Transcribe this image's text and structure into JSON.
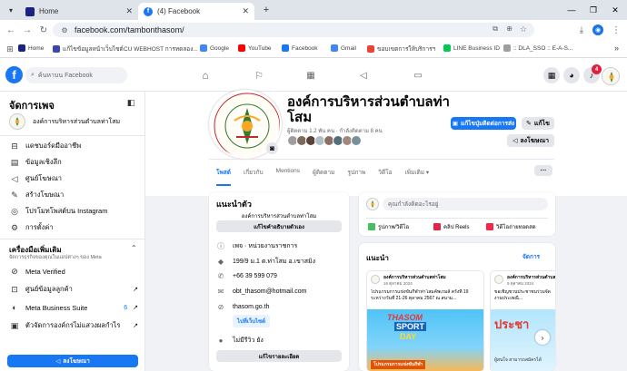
{
  "browser": {
    "tabs": [
      {
        "title": "Home",
        "active": false
      },
      {
        "title": "(4) Facebook",
        "active": true
      }
    ],
    "new_tab_label": "+",
    "url": "facebook.com/tambonthasom/",
    "bookmarks": [
      {
        "label": "Home",
        "color": "#1a237e"
      },
      {
        "label": "แก้ไขข้อมูลหน้าเว็บไซต์",
        "color": "#3949ab"
      },
      {
        "label": "CU WEBHOST การทดลอง...",
        "color": "#9e9e9e"
      },
      {
        "label": "Google",
        "color": "#4285f4"
      },
      {
        "label": "YouTube",
        "color": "#ff0000"
      },
      {
        "label": "Facebook",
        "color": "#1877f2"
      },
      {
        "label": "Gmail",
        "color": "#4285f4"
      },
      {
        "label": "ขอบเขตการให้บริการฯ",
        "color": "#ea4335"
      },
      {
        "label": "LINE Business ID",
        "color": "#06c755"
      },
      {
        "label": ":: DLA_SSO :: E-A-S...",
        "color": "#9e9e9e"
      }
    ],
    "bookmarks_more": "»"
  },
  "facebook": {
    "search_placeholder": "ค้นหาบน Facebook",
    "notification_count": "4"
  },
  "left_panel": {
    "title": "จัดการเพจ",
    "page_name": "องค์การบริหารส่วนตำบลท่าโสม",
    "items": [
      {
        "label": "แดชบอร์ดมืออาชีพ",
        "icon": "dashboard-icon"
      },
      {
        "label": "ข้อมูลเชิงลึก",
        "icon": "insights-icon"
      },
      {
        "label": "ศูนย์โฆษณา",
        "icon": "megaphone-icon"
      },
      {
        "label": "สร้างโฆษณา",
        "icon": "create-ad-icon"
      },
      {
        "label": "โปรโมทโพสต์บน Instagram",
        "icon": "instagram-icon"
      },
      {
        "label": "การตั้งค่า",
        "icon": "settings-icon"
      }
    ],
    "tools_title": "เครื่องมือเพิ่มเติม",
    "tools_subtitle": "จัดการธุรกิจของคุณในแอปต่างๆ ของ Meta",
    "tools": [
      {
        "label": "Meta Verified",
        "badge": "",
        "icon": "verified-icon"
      },
      {
        "label": "ศูนย์ข้อมูลลูกค้า",
        "badge": "",
        "icon": "customer-icon"
      },
      {
        "label": "Meta Business Suite",
        "badge": "6",
        "icon": "business-suite-icon"
      },
      {
        "label": "ตัวจัดการองค์กรไม่แสวงผลกำไร",
        "icon": "nonprofit-icon",
        "badge": ""
      }
    ],
    "advertise_button": "ลงโฆษณา"
  },
  "profile": {
    "name": "องค์การบริหารส่วนตำบลท่าโสม",
    "stats": "ผู้ติดตาม 1.2 พัน คน · กำลังติดตาม 8 คน",
    "edit_contact_button": "แก้ไขปุ่มติดต่อการส่ง",
    "edit_button": "แก้ไข",
    "advertise_button": "ลงโฆษณา",
    "tabs": [
      "โพสต์",
      "เกี่ยวกับ",
      "Mentions",
      "ผู้ติดตาม",
      "รูปภาพ",
      "วิดีโอ",
      "เพิ่มเติม ▾"
    ],
    "more_button": "···"
  },
  "intro": {
    "title": "แนะนำตัว",
    "bio": "องค์การบริหารส่วนตำบลท่าโสม",
    "edit_bio_button": "แก้ไขคำอธิบายตัวเอง",
    "rows": [
      {
        "icon": "info-icon",
        "text": "เพจ · หน่วยงานราชการ"
      },
      {
        "icon": "location-icon",
        "text": "199/9 ม.1 ต.ท่าโสม อ.เขาสมิง"
      },
      {
        "icon": "phone-icon",
        "text": "+66 39 599 079"
      },
      {
        "icon": "email-icon",
        "text": "obt_thasom@hotmail.com"
      },
      {
        "icon": "link-icon",
        "text": "thasom.go.th"
      }
    ],
    "website_link": "ไปที่เว็บไซต์",
    "rating_label": "ไม่มีรีวิว ยัง",
    "edit_details_button": "แก้ไขรายละเอียด"
  },
  "composer": {
    "placeholder": "คุณกำลังคิดอะไรอยู่",
    "actions": [
      {
        "label": "รูปภาพ/วิดีโอ",
        "color": "#45bd62"
      },
      {
        "label": "คลิป Reels",
        "color": "#e42645"
      },
      {
        "label": "วิดีโอถ่ายทอดสด",
        "color": "#f02849"
      }
    ]
  },
  "featured": {
    "title": "แนะนำ",
    "manage_link": "จัดการ",
    "posts": [
      {
        "author": "องค์การบริหารส่วนตำบลท่าโสม",
        "date": "16 ตุลาคม 2024",
        "text": "โปรแกรมการแข่งขันกีฬาท่าโสมคัพเกมส์ ครั้งที่ 19 ระหว่างวันที่ 21-26 ตุลาคม 2567 ณ สนาม...",
        "banner_line1": "THASOM",
        "banner_line2": "SPORT",
        "banner_line3": "DAY",
        "caption": "โปรแกรมการแข่งขันกีฬา"
      },
      {
        "author": "องค์การบริหารส่วนตำบลท่าโสม",
        "date": "9 ตุลาคม 2024",
        "text": "ขอเชิญชวนประชาชนร่วมจัดงานประเพณี...",
        "banner_line1": "ประชา",
        "caption": "ผู้สนใจ สามารถสมัครได้"
      }
    ]
  },
  "colors": {
    "fb_blue": "#1877f2",
    "text_secondary": "#65676b",
    "button_gray": "#e4e6eb"
  }
}
